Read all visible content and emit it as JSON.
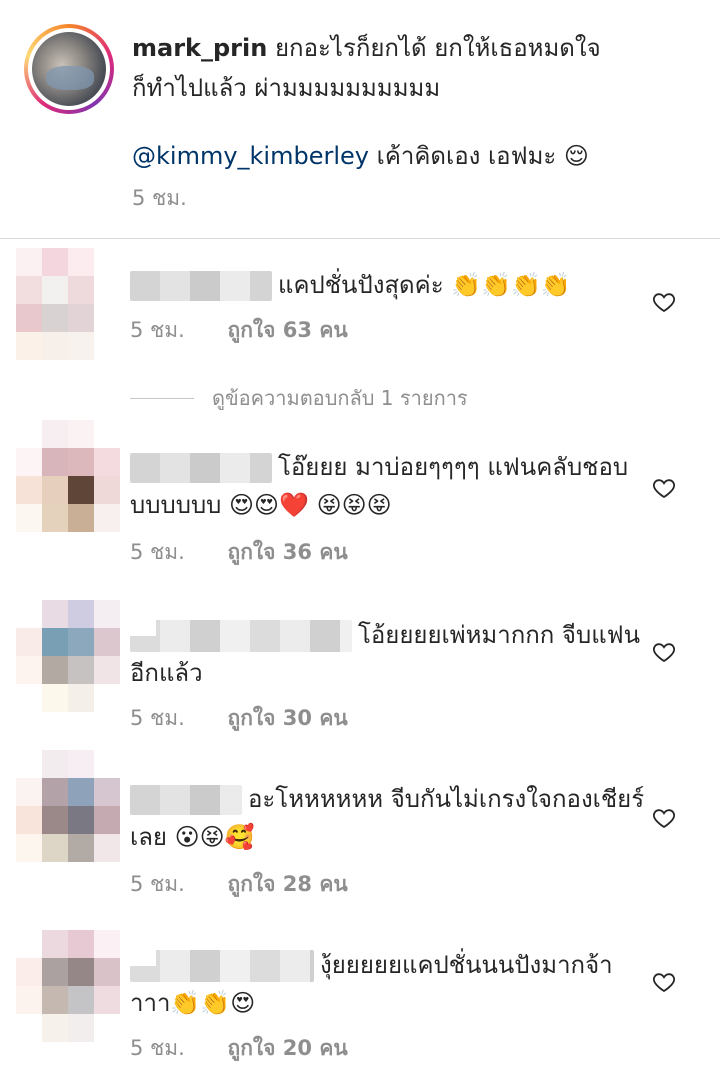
{
  "post": {
    "username": "mark_prin",
    "caption_line1": "ยกอะไรก็ยกได้  ยกให้เธอหมดใจ",
    "caption_line2": "ก็ทำไปแล้ว ผ่ามมมมมมมมมม",
    "mention": "@kimmy_kimberley",
    "mention_text": "เค้าคิดเอง เอฟมะ 😌",
    "time": "5 ชม."
  },
  "view_replies_label": "ดูข้อความตอบกลับ 1 รายการ",
  "comments": [
    {
      "text": "แคปชั่นปังสุดค่ะ 👏👏👏👏",
      "time": "5 ชม.",
      "likes": "ถูกใจ 63 คน",
      "heart_icon": "heart-outline-icon"
    },
    {
      "text": "โอ๊ยยย มาบ่อยๆๆๆๆ แฟนคลับชอบบบบบบบ 😍😍❤️ 😝😝😝",
      "time": "5 ชม.",
      "likes": "ถูกใจ 36 คน",
      "heart_icon": "heart-outline-icon"
    },
    {
      "text": "โอ้ยยยยเพ่หมากกก จีบแฟนอีกแล้ว",
      "time": "5 ชม.",
      "likes": "ถูกใจ 30 คน",
      "heart_icon": "heart-outline-icon"
    },
    {
      "text": "อะโหหหหหห จีบกันไม่เกรงใจกองเชียร์เลย 😮😝🥰",
      "time": "5 ชม.",
      "likes": "ถูกใจ 28 คน",
      "heart_icon": "heart-outline-icon"
    },
    {
      "text": "งุ้ยยยยยแคปชั่นนนปังมากจ้าาาา👏👏😍",
      "time": "5 ชม.",
      "likes": "ถูกใจ 20 คน",
      "heart_icon": "heart-outline-icon"
    }
  ],
  "colors": {
    "text": "#262626",
    "secondary": "#8e8e8e",
    "mention": "#003569",
    "divider": "#dbdbdb"
  }
}
